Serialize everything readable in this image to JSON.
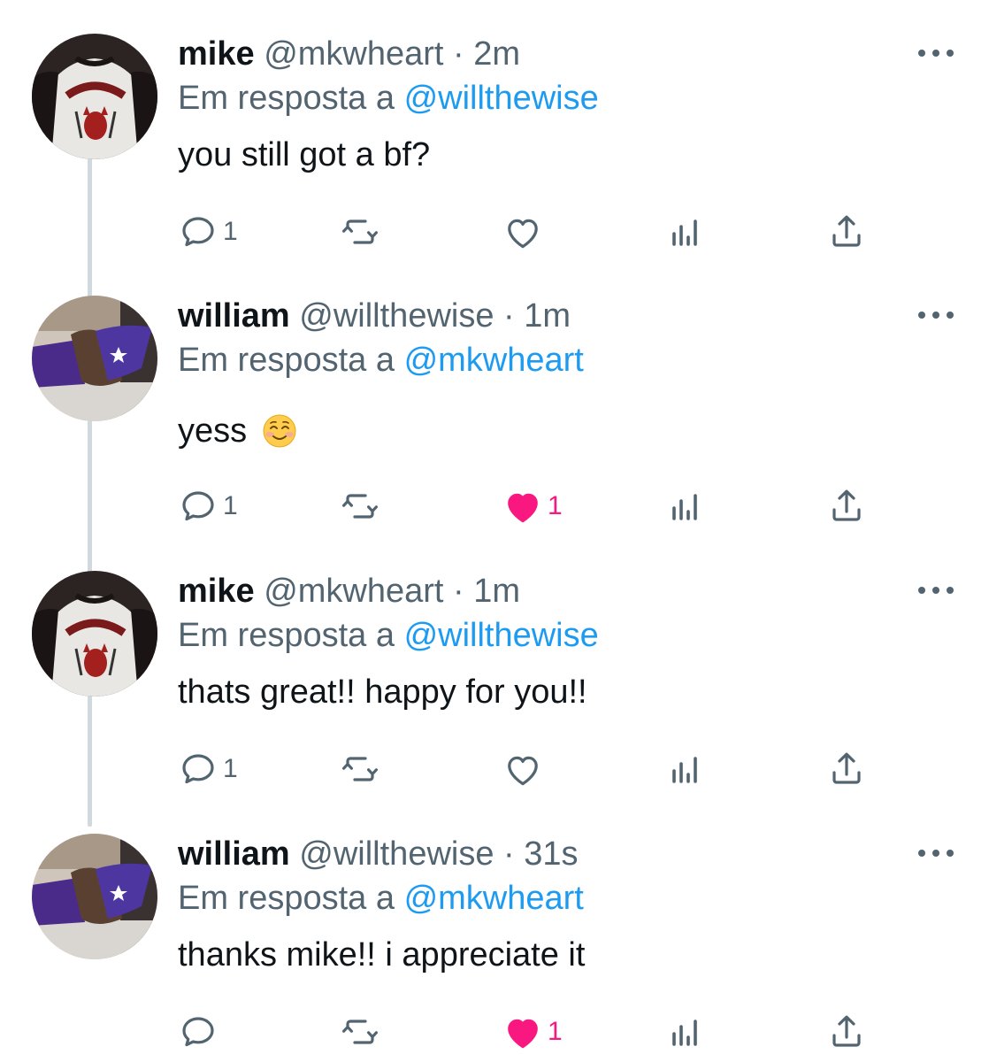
{
  "tweets": [
    {
      "name": "mike",
      "handle": "@mkwheart",
      "sep": "·",
      "time": "2m",
      "reply_prefix": "Em resposta a",
      "reply_to": "@willthewise",
      "text": "you still got a bf?",
      "emoji": "",
      "avatar": "hellfire-shirt",
      "reply_count": "1",
      "retweet_count": "",
      "like_count": "",
      "liked": false
    },
    {
      "name": "william",
      "handle": "@willthewise",
      "sep": "·",
      "time": "1m",
      "reply_prefix": "Em resposta a",
      "reply_to": "@mkwheart",
      "text": "yess",
      "emoji": "smiling-face-emoji",
      "avatar": "wizard-hat",
      "reply_count": "1",
      "retweet_count": "",
      "like_count": "1",
      "liked": true
    },
    {
      "name": "mike",
      "handle": "@mkwheart",
      "sep": "·",
      "time": "1m",
      "reply_prefix": "Em resposta a",
      "reply_to": "@willthewise",
      "text": "thats great!! happy for you!!",
      "emoji": "",
      "avatar": "hellfire-shirt",
      "reply_count": "1",
      "retweet_count": "",
      "like_count": "",
      "liked": false
    },
    {
      "name": "william",
      "handle": "@willthewise",
      "sep": "·",
      "time": "31s",
      "reply_prefix": "Em resposta a",
      "reply_to": "@mkwheart",
      "text": "thanks mike!! i appreciate it",
      "emoji": "",
      "avatar": "wizard-hat",
      "reply_count": "",
      "retweet_count": "",
      "like_count": "1",
      "liked": true
    }
  ],
  "colors": {
    "text": "#0f1419",
    "secondary": "#536471",
    "link": "#1d9bf0",
    "like_active": "#f91880",
    "thread_line": "#cfd9de"
  },
  "icons": [
    "reply-icon",
    "retweet-icon",
    "heart-icon",
    "analytics-icon",
    "share-icon",
    "more-icon"
  ]
}
